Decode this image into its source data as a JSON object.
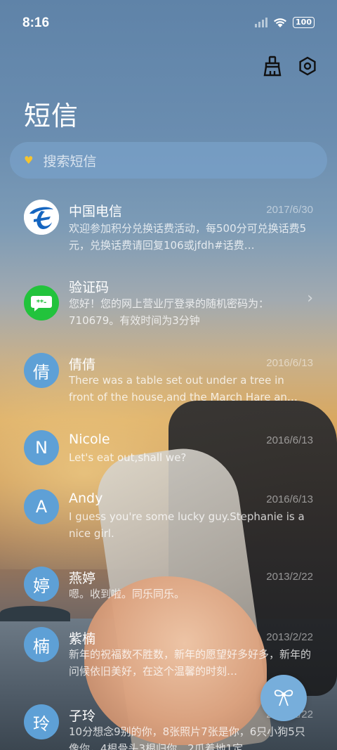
{
  "status_bar": {
    "time": "8:16",
    "battery": "100"
  },
  "header": {
    "title": "短信",
    "actions": [
      "broom-icon",
      "settings-icon"
    ]
  },
  "search": {
    "placeholder": "搜索短信",
    "icon": "heart-icon"
  },
  "threads": [
    {
      "name": "中国电信",
      "date": "2017/6/30",
      "preview": "欢迎参加积分兑换话费活动，每500分可兑换话费5元，兑换话费请回复106或jfdh#话费…",
      "avatar": "china-telecom-logo"
    },
    {
      "name": "验证码",
      "date": "",
      "preview": "您好！您的网上营业厅登录的随机密码为：710679。有效时间为3分钟",
      "avatar": "chat-bubble-icon"
    },
    {
      "name": "倩倩",
      "date": "2016/6/13",
      "preview": "There was a table set out under a tree in front of the house,and the March Hare an…",
      "avatar": "倩"
    },
    {
      "name": "Nicole",
      "date": "2016/6/13",
      "preview": "Let's eat out,shall we?",
      "avatar": "N"
    },
    {
      "name": "Andy",
      "date": "2016/6/13",
      "preview": "I guess you're some lucky guy.Stephanie is a nice girl.",
      "avatar": "A"
    },
    {
      "name": "燕婷",
      "date": "2013/2/22",
      "preview": "嗯。收到啦。同乐同乐。",
      "avatar": "婷"
    },
    {
      "name": "紫楠",
      "date": "2013/2/22",
      "preview": "新年的祝福数不胜数，新年的愿望好多好多，新年的问候依旧美好，在这个温馨的时刻…",
      "avatar": "楠"
    },
    {
      "name": "子玲",
      "date": "2013/2/22",
      "preview": "10分想念9别的你，8张照片7张是你，6只小狗5只像你，4根骨头3根归你，2爪着地1定…",
      "avatar": "玲"
    }
  ],
  "fab": {
    "icon": "bow-icon"
  },
  "colors": {
    "avatar_blue": "#5ea0d6",
    "chat_green": "#22c33c",
    "telecom_blue": "#1565c0",
    "fab_blue": "#77aedb"
  }
}
